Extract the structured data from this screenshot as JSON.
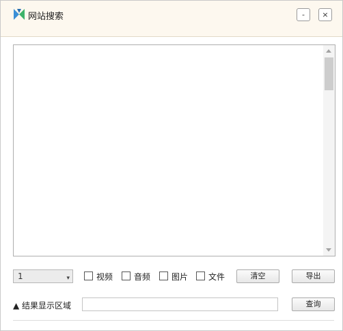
{
  "window": {
    "title": "网站搜索",
    "minimize_label": "-",
    "close_label": "×"
  },
  "results_area": {
    "text": ""
  },
  "controls": {
    "select": {
      "selected": "1",
      "caret": "▾"
    },
    "checkboxes": [
      {
        "label": "视频",
        "checked": false
      },
      {
        "label": "音频",
        "checked": false
      },
      {
        "label": "图片",
        "checked": false
      },
      {
        "label": "文件",
        "checked": false
      }
    ],
    "clear_label": "清空",
    "export_label": "导出"
  },
  "query": {
    "area_label": "▲ 结果显示区域",
    "input_value": "",
    "query_label": "查询"
  },
  "colors": {
    "titlebar_bg": "#fdf8ef",
    "icon_blue": "#3a8fd6",
    "icon_green": "#3db36b"
  }
}
